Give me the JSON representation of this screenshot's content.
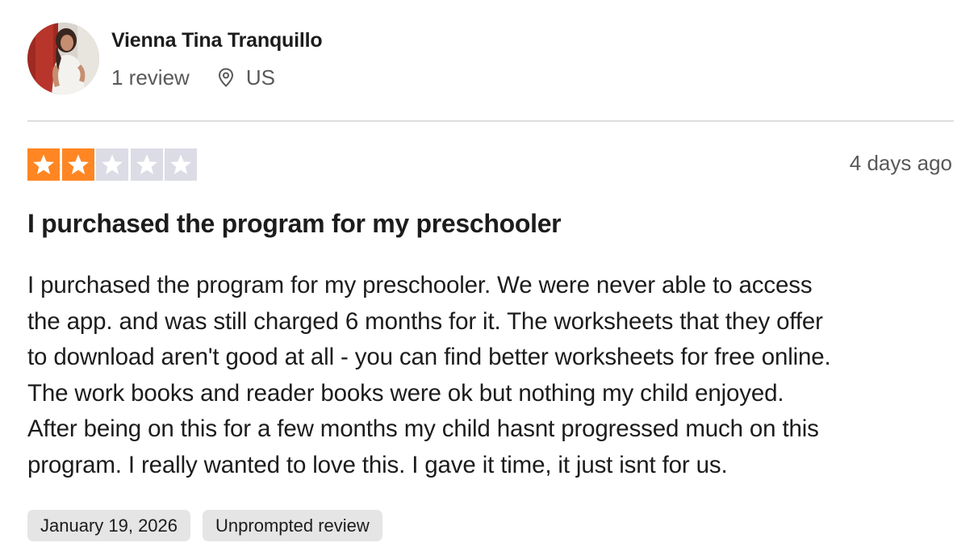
{
  "reviewer": {
    "name": "Vienna Tina Tranquillo",
    "review_count": "1 review",
    "location": "US",
    "avatar_icon": "user-avatar-photo",
    "location_icon": "map-pin-icon"
  },
  "review": {
    "rating": 2,
    "max_rating": 5,
    "date_ago": "4 days ago",
    "title": "I purchased the program for my preschooler",
    "body": "I purchased the program for my preschooler.  We were never able to access\nthe app.  and was still charged 6 months for it.  The worksheets that they offer\nto download aren't good at all - you can find better worksheets for free online.\nThe work books and reader books were ok but nothing my child enjoyed.\nAfter being on this for a few months my child hasnt progressed much on this\nprogram.  I really wanted to love this.  I gave it time, it just isnt for us.",
    "tags": [
      "January 19, 2026",
      "Unprompted review"
    ]
  },
  "colors": {
    "star_filled": "#ff8622",
    "star_empty": "#dcdce6",
    "divider": "#dedede",
    "tag_bg": "#e5e5e5"
  }
}
